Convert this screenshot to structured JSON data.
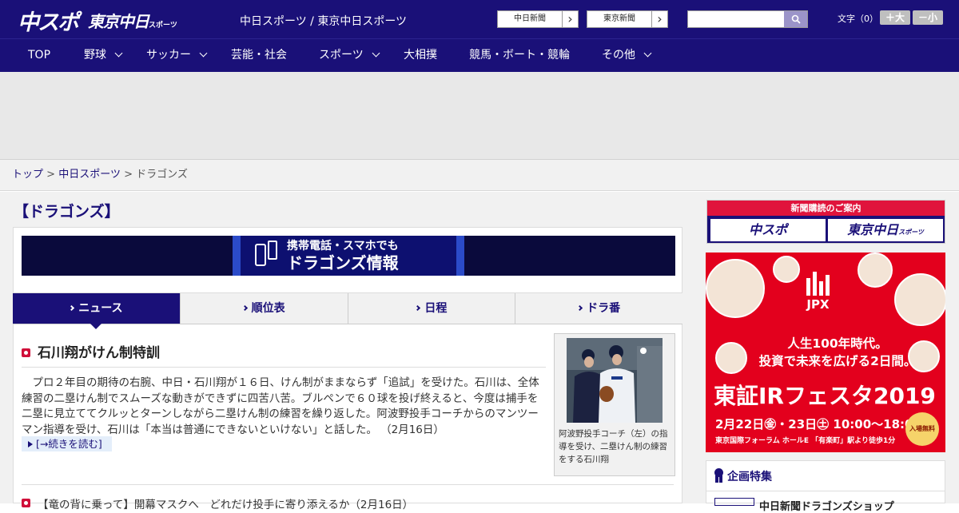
{
  "header": {
    "logo_primary": "中スポ",
    "logo_secondary": "東京中日",
    "logo_secondary_small": "スポーツ",
    "site_name": "中日スポーツ / 東京中日スポーツ",
    "ext_links": [
      {
        "label": "中日新聞",
        "arrow": "›"
      },
      {
        "label": "東京新聞",
        "arrow": "›"
      }
    ],
    "search": {
      "value": "",
      "placeholder": ""
    },
    "font_size_label": "文字（0）",
    "font_bigger": "＋大",
    "font_smaller": "－小"
  },
  "nav": {
    "items": [
      {
        "label": "TOP",
        "dropdown": false
      },
      {
        "label": "野球",
        "dropdown": true
      },
      {
        "label": "サッカー",
        "dropdown": true
      },
      {
        "label": "芸能・社会",
        "dropdown": false
      },
      {
        "label": "スポーツ",
        "dropdown": true
      },
      {
        "label": "大相撲",
        "dropdown": false
      },
      {
        "label": "競馬・ボート・競輪",
        "dropdown": false
      },
      {
        "label": "その他",
        "dropdown": true
      }
    ]
  },
  "breadcrumb": {
    "items": [
      "トップ",
      "中日スポーツ",
      "ドラゴンズ"
    ],
    "separator": ">"
  },
  "main": {
    "section_title": "【ドラゴンズ】",
    "promo_line1": "携帯電話・スマホでも",
    "promo_line2": "ドラゴンズ情報",
    "tabs": [
      {
        "label": "ニュース",
        "active": true
      },
      {
        "label": "順位表",
        "active": false
      },
      {
        "label": "日程",
        "active": false
      },
      {
        "label": "ドラ番",
        "active": false
      }
    ],
    "article": {
      "title": "石川翔がけん制特訓",
      "body": "プロ２年目の期待の右腕、中日・石川翔が１６日、けん制がままならず「追試」を受けた。石川は、全体練習の二塁けん制でスムーズな動きができずに四苦八苦。ブルペンで６０球を投げ終えると、今度は捕手を二塁に見立ててクルッとターンしながら二塁けん制の練習を繰り返した。阿波野投手コーチからのマンツーマン指導を受け、石川は「本当は普通にできないといけない」と話した。 （2月16日）",
      "more_label": "[→続きを読む]",
      "photo_caption": "阿波野投手コーチ（左）の指導を受け、二塁けん制の練習をする石川翔"
    },
    "next_item": "【竜の背に乗って】開幕マスクへ　どれだけ投手に寄り添えるか（2月16日）"
  },
  "sidebar": {
    "subscribe_title": "新聞購読のご案内",
    "subscribe_logos": [
      "中スポ",
      "東京中日"
    ],
    "subscribe_logo_small": "スポーツ",
    "ad": {
      "brand": "JPX",
      "copy_line1": "人生100年時代。",
      "copy_line2": "投資で未来を広げる2日間。",
      "fes_title": "東証IRフェスタ2019",
      "date": "2月22日㊎・23日㊏ 10:00～18:00",
      "place": "東京国際フォーラム ホールE 「有楽町」駅より徒歩1分",
      "badge": "入場無料"
    },
    "feature_title": "企画特集",
    "feature_item": "中日新聞ドラゴンズショップ"
  },
  "colors": {
    "brand_navy": "#1a1078",
    "accent_red": "#d0103a",
    "ad_red": "#e3001d"
  }
}
